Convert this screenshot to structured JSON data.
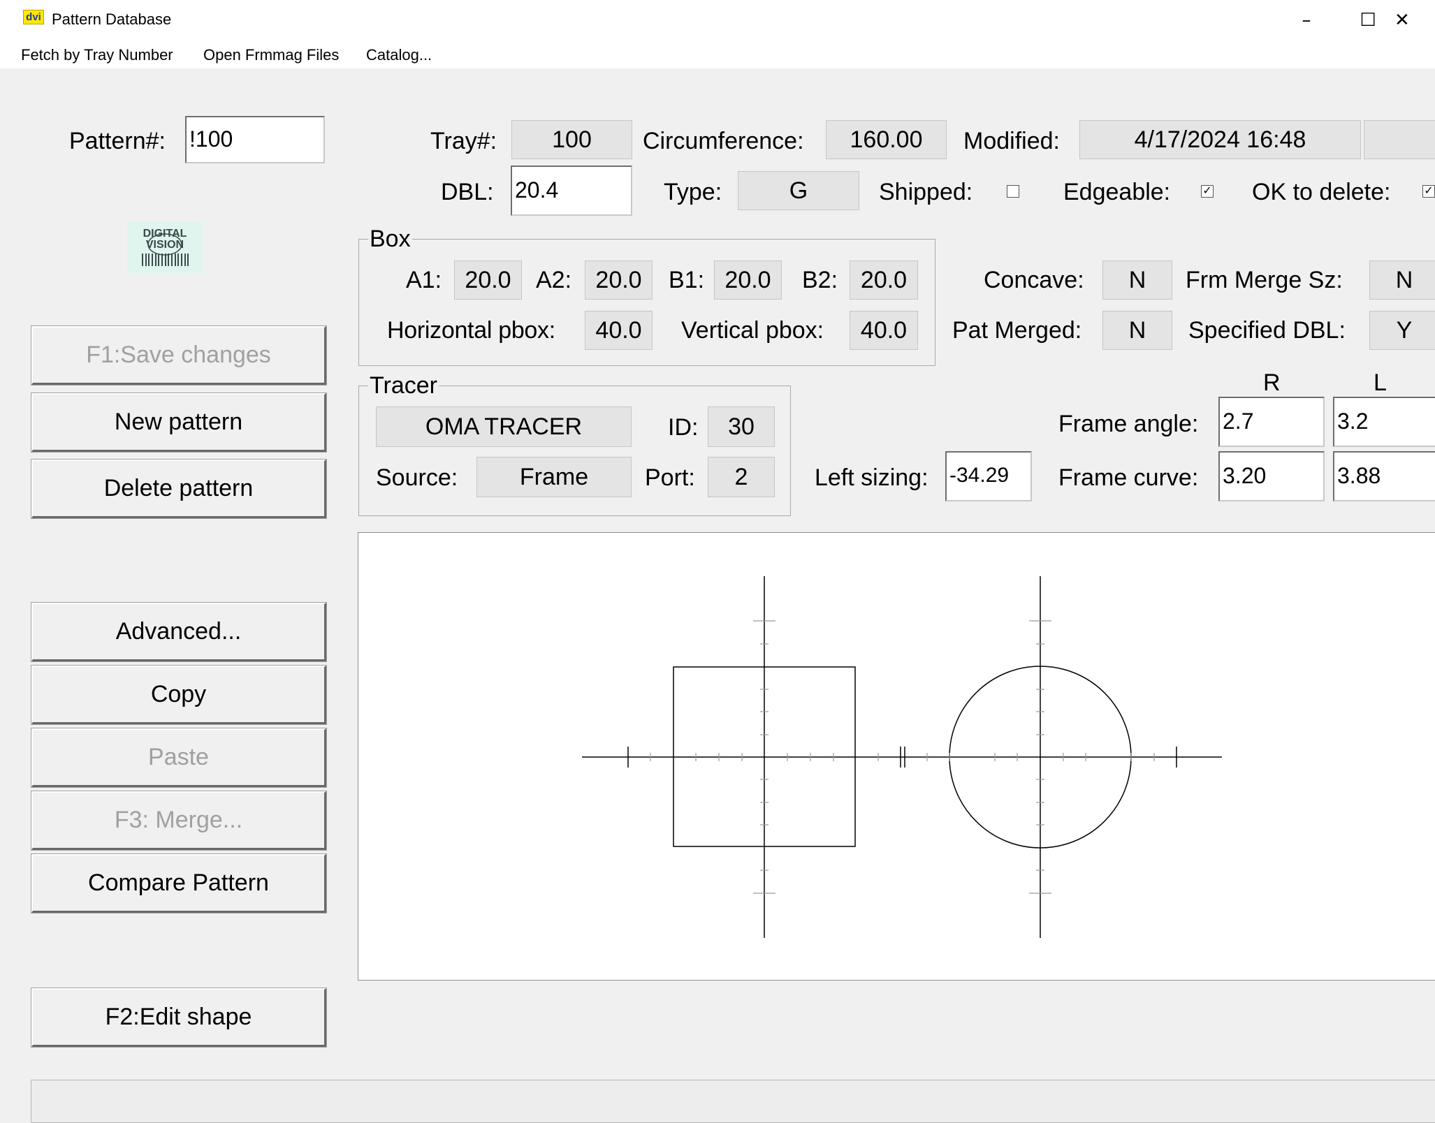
{
  "window": {
    "icon_text": "dvi",
    "title": "Pattern Database",
    "minimize": "–",
    "maximize": "☐",
    "close": "✕"
  },
  "menu": {
    "items": [
      "Fetch by Tray Number",
      "Open Frmmag Files",
      "Catalog..."
    ]
  },
  "pattern": {
    "label": "Pattern#:",
    "value": "!100"
  },
  "tray": {
    "label": "Tray#:",
    "value": "100"
  },
  "circumference": {
    "label": "Circumference:",
    "value": "160.00"
  },
  "modified": {
    "label": "Modified:",
    "value": "4/17/2024 16:48",
    "extra": ""
  },
  "dbl": {
    "label": "DBL:",
    "value": "20.4"
  },
  "type": {
    "label": "Type:",
    "value": "G"
  },
  "shipped": {
    "label": "Shipped:",
    "checked": false
  },
  "edgeable": {
    "label": "Edgeable:",
    "checked": true
  },
  "ok_to_delete": {
    "label": "OK to delete:",
    "checked": true
  },
  "box": {
    "legend": "Box",
    "a1_label": "A1:",
    "a1": "20.0",
    "a2_label": "A2:",
    "a2": "20.0",
    "b1_label": "B1:",
    "b1": "20.0",
    "b2_label": "B2:",
    "b2": "20.0",
    "hpbox_label": "Horizontal pbox:",
    "hpbox": "40.0",
    "vpbox_label": "Vertical pbox:",
    "vpbox": "40.0"
  },
  "concave": {
    "label": "Concave:",
    "value": "N"
  },
  "frm_merge_sz": {
    "label": "Frm Merge Sz:",
    "value": "N"
  },
  "pat_merged": {
    "label": "Pat Merged:",
    "value": "N"
  },
  "specified_dbl": {
    "label": "Specified DBL:",
    "value": "Y"
  },
  "tracer": {
    "legend": "Tracer",
    "name": "OMA TRACER",
    "id_label": "ID:",
    "id": "30",
    "source_label": "Source:",
    "source": "Frame",
    "port_label": "Port:",
    "port": "2"
  },
  "left_sizing": {
    "label": "Left sizing:",
    "value": "-34.29"
  },
  "eyes": {
    "r_label": "R",
    "l_label": "L"
  },
  "frame_angle": {
    "label": "Frame angle:",
    "r": "2.7",
    "l": "3.2"
  },
  "frame_curve": {
    "label": "Frame curve:",
    "r": "3.20",
    "l": "3.88"
  },
  "buttons": {
    "save": "F1:Save changes",
    "new_pattern": "New pattern",
    "delete_pattern": "Delete pattern",
    "advanced": "Advanced...",
    "copy": "Copy",
    "paste": "Paste",
    "merge": "F3: Merge...",
    "compare": "Compare Pattern",
    "edit_shape": "F2:Edit shape"
  },
  "colors": {
    "window_bg": "#f0f0f0",
    "readonly_bg": "#e4e4e4",
    "disabled_text": "#a0a0a0",
    "icon_yellow": "#ffe800"
  }
}
